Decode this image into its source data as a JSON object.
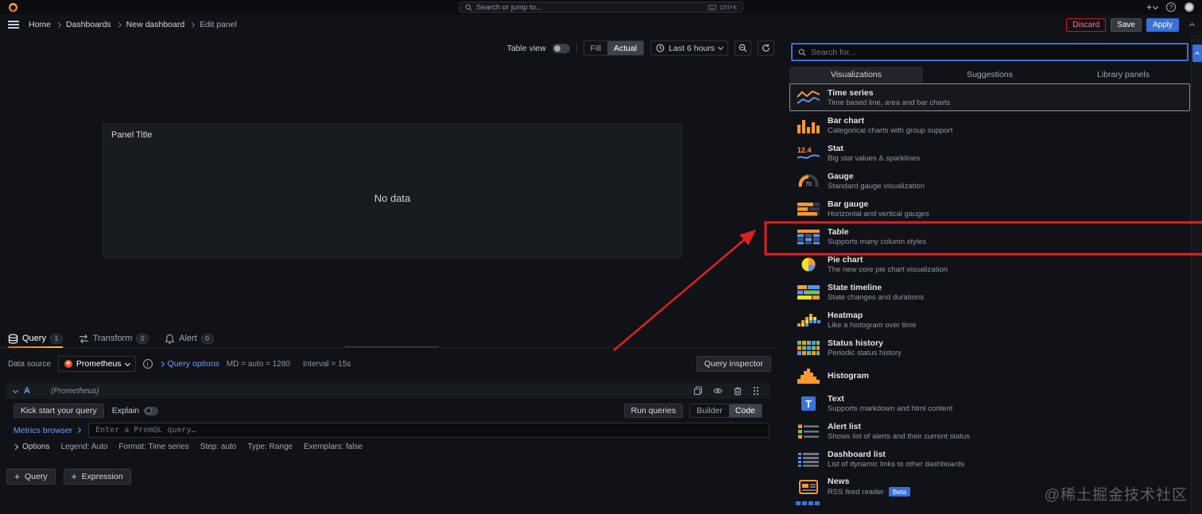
{
  "topnav": {
    "search_placeholder": "Search or jump to...",
    "shortcut": "ctrl+k",
    "icons": [
      "grafana-logo",
      "search-icon",
      "keyboard-icon",
      "plus-icon",
      "chevron-down-icon",
      "help-circle-icon",
      "user-avatar"
    ]
  },
  "breadcrumb": {
    "items": [
      "Home",
      "Dashboards",
      "New dashboard",
      "Edit panel"
    ]
  },
  "header_actions": {
    "discard": "Discard",
    "save": "Save",
    "apply": "Apply"
  },
  "panel_controls": {
    "table_view_label": "Table view",
    "fill": "Fill",
    "actual": "Actual",
    "time_range": "Last 6 hours",
    "icons": [
      "clock-icon",
      "zoom-out-icon",
      "refresh-icon"
    ]
  },
  "panel": {
    "title": "Panel Title",
    "no_data": "No data"
  },
  "editor_tabs": [
    {
      "label": "Query",
      "badge": "1",
      "icon": "database-icon",
      "active": true
    },
    {
      "label": "Transform",
      "badge": "0",
      "icon": "transform-icon",
      "active": false
    },
    {
      "label": "Alert",
      "badge": "0",
      "icon": "bell-icon",
      "active": false
    }
  ],
  "query_toolbar": {
    "datasource_label": "Data source",
    "datasource": "Prometheus",
    "query_options": "Query options",
    "summary_md": "MD = auto = 1280",
    "summary_interval": "Interval = 15s",
    "query_inspector": "Query inspector"
  },
  "query_editor": {
    "ref_id": "A",
    "datasource_hint": "(Prometheus)",
    "kick_start": "Kick start your query",
    "explain": "Explain",
    "run_queries": "Run queries",
    "builder": "Builder",
    "code": "Code",
    "metrics_browser": "Metrics browser",
    "promql_placeholder": "Enter a PromQL query…",
    "options_label": "Options",
    "options_items": [
      "Legend: Auto",
      "Format: Time series",
      "Step: auto",
      "Type: Range",
      "Exemplars: false"
    ],
    "header_icons": [
      "duplicate-icon",
      "eye-icon",
      "trash-icon",
      "drag-handle"
    ]
  },
  "footer_actions": {
    "add_query": "Query",
    "add_expression": "Expression"
  },
  "viz_picker": {
    "search_placeholder": "Search for...",
    "tabs": [
      {
        "label": "Visualizations",
        "active": true
      },
      {
        "label": "Suggestions",
        "active": false
      },
      {
        "label": "Library panels",
        "active": false
      }
    ],
    "items": [
      {
        "name": "Time series",
        "desc": "Time based line, area and bar charts",
        "icon": "time-series-icon",
        "selected": true
      },
      {
        "name": "Bar chart",
        "desc": "Categorical charts with group support",
        "icon": "bar-chart-icon"
      },
      {
        "name": "Stat",
        "desc": "Big stat values & sparklines",
        "icon": "stat-icon"
      },
      {
        "name": "Gauge",
        "desc": "Standard gauge visualization",
        "icon": "gauge-icon"
      },
      {
        "name": "Bar gauge",
        "desc": "Horizontal and vertical gauges",
        "icon": "bar-gauge-icon"
      },
      {
        "name": "Table",
        "desc": "Supports many column styles",
        "icon": "table-icon",
        "annotated": true
      },
      {
        "name": "Pie chart",
        "desc": "The new core pie chart visualization",
        "icon": "pie-chart-icon"
      },
      {
        "name": "State timeline",
        "desc": "State changes and durations",
        "icon": "state-timeline-icon"
      },
      {
        "name": "Heatmap",
        "desc": "Like a histogram over time",
        "icon": "heatmap-icon"
      },
      {
        "name": "Status history",
        "desc": "Periodic status history",
        "icon": "status-history-icon"
      },
      {
        "name": "Histogram",
        "desc": "",
        "icon": "histogram-icon"
      },
      {
        "name": "Text",
        "desc": "Supports markdown and html content",
        "icon": "text-icon"
      },
      {
        "name": "Alert list",
        "desc": "Shows list of alerts and their current status",
        "icon": "alert-list-icon"
      },
      {
        "name": "Dashboard list",
        "desc": "List of dynamic links to other dashboards",
        "icon": "dashboard-list-icon"
      },
      {
        "name": "News",
        "desc": "RSS feed reader",
        "icon": "news-icon",
        "badge": "Beta"
      }
    ]
  },
  "annotation": {
    "color": "#e02020",
    "target": "Table"
  },
  "watermark": "@稀土掘金技术社区",
  "colors": {
    "accent_blue": "#3871dc",
    "orange": "#ff9830",
    "background": "#111217",
    "panel": "#181b1f"
  }
}
